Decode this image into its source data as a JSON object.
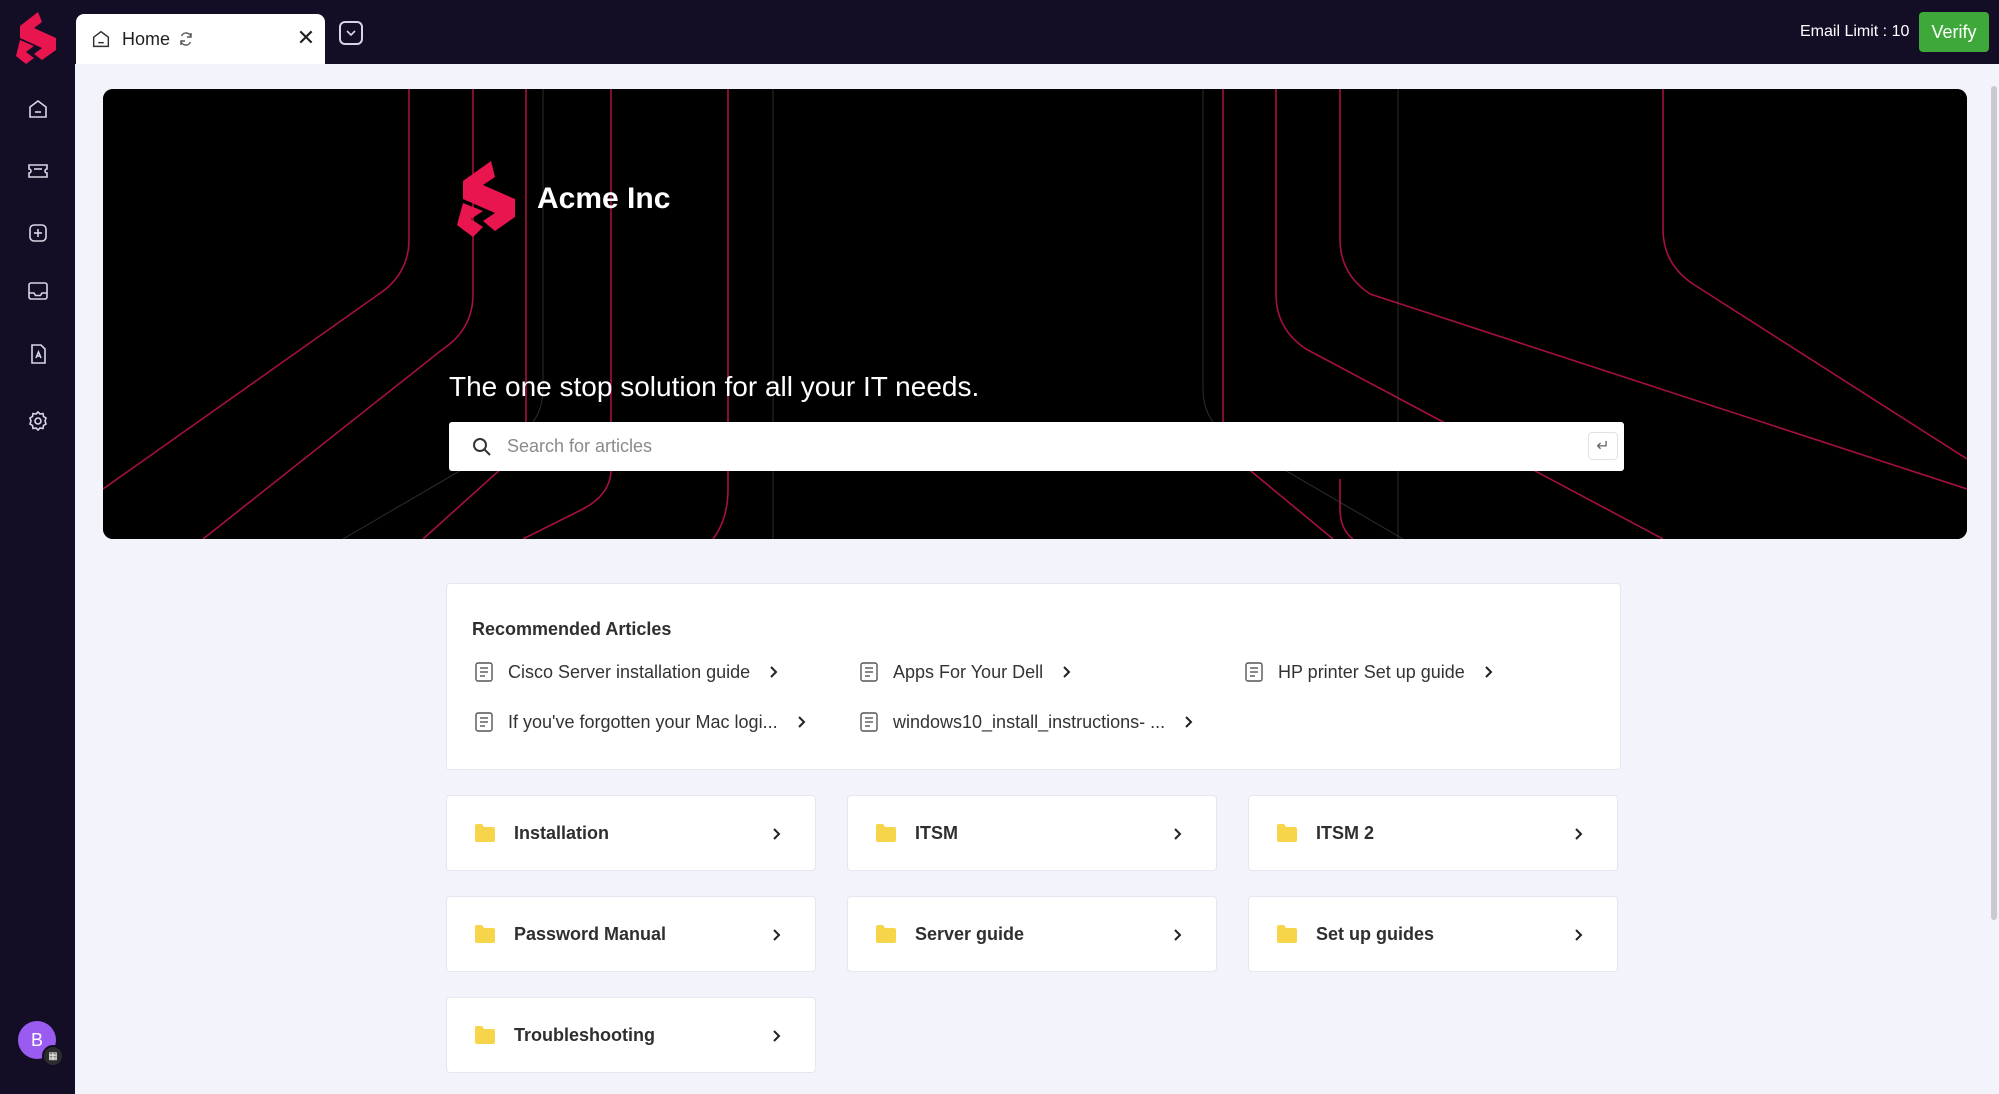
{
  "tab": {
    "label": "Home"
  },
  "topbar": {
    "email_limit": "Email Limit : 10",
    "verify_label": "Verify"
  },
  "user": {
    "avatar_initial": "B"
  },
  "hero": {
    "brand_name": "Acme Inc",
    "tagline": "The one stop solution for all your IT needs.",
    "search_placeholder": "Search for articles",
    "enter_key": "↵"
  },
  "recommended": {
    "title": "Recommended Articles",
    "items": [
      {
        "label": "Cisco Server installation guide"
      },
      {
        "label": "Apps For Your Dell"
      },
      {
        "label": "HP printer Set up guide"
      },
      {
        "label": "If you've forgotten your Mac logi..."
      },
      {
        "label": "windows10_install_instructions- ..."
      }
    ]
  },
  "categories": [
    {
      "label": "Installation"
    },
    {
      "label": "ITSM"
    },
    {
      "label": "ITSM 2"
    },
    {
      "label": "Password Manual"
    },
    {
      "label": "Server guide"
    },
    {
      "label": "Set up guides"
    },
    {
      "label": "Troubleshooting"
    }
  ],
  "colors": {
    "brand": "#e8154f",
    "sidebar": "#130d26",
    "verify": "#3ea93a",
    "folder": "#f7d54a"
  },
  "icons": [
    "home-icon",
    "ticket-icon",
    "plus-square-icon",
    "inbox-icon",
    "document-icon",
    "gear-icon"
  ]
}
